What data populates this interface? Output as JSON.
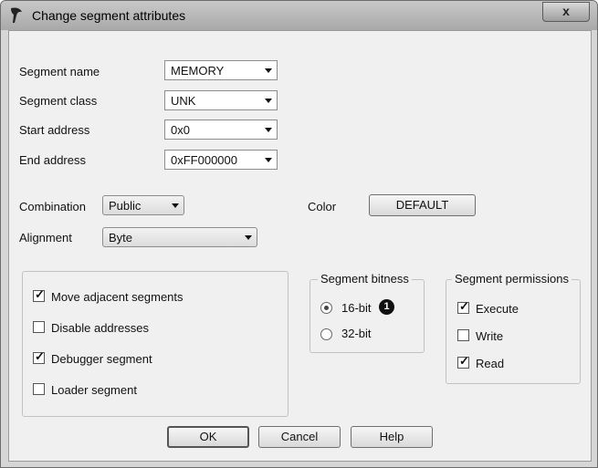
{
  "window": {
    "title": "Change segment attributes",
    "close_label": "x"
  },
  "fields": {
    "segment_name_label": "Segment name",
    "segment_name_value": "MEMORY",
    "segment_class_label": "Segment class",
    "segment_class_value": "UNK",
    "start_address_label": "Start address",
    "start_address_value": "0x0",
    "end_address_label": "End address",
    "end_address_value": "0xFF000000",
    "combination_label": "Combination",
    "combination_value": "Public",
    "alignment_label": "Alignment",
    "alignment_value": "Byte",
    "color_label": "Color",
    "color_button": "DEFAULT"
  },
  "options": {
    "move_adjacent": {
      "label": "Move adjacent segments",
      "checked": true
    },
    "disable_addresses": {
      "label": "Disable addresses",
      "checked": false
    },
    "debugger_segment": {
      "label": "Debugger segment",
      "checked": true
    },
    "loader_segment": {
      "label": "Loader segment",
      "checked": false
    }
  },
  "bitness": {
    "title": "Segment bitness",
    "opt16": {
      "label": "16-bit",
      "selected": true
    },
    "opt32": {
      "label": "32-bit",
      "selected": false
    },
    "callout": "1"
  },
  "permissions": {
    "title": "Segment permissions",
    "execute": {
      "label": "Execute",
      "checked": true
    },
    "write": {
      "label": "Write",
      "checked": false
    },
    "read": {
      "label": "Read",
      "checked": true
    }
  },
  "buttons": {
    "ok": "OK",
    "cancel": "Cancel",
    "help": "Help"
  }
}
